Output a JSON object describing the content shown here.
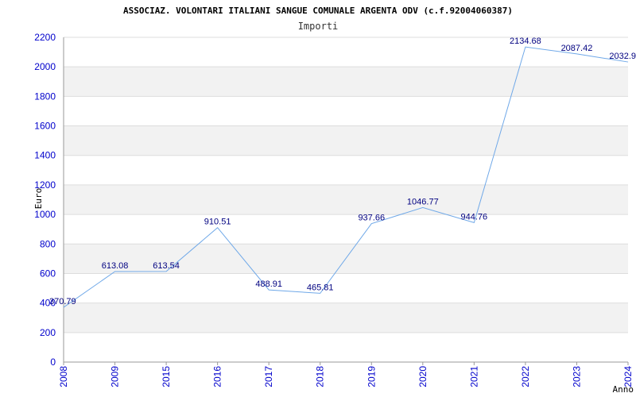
{
  "chart_data": {
    "type": "line",
    "title": "ASSOCIAZ. VOLONTARI ITALIANI SANGUE COMUNALE ARGENTA ODV (c.f.92004060387)",
    "subtitle": "Importi",
    "ylabel": "Euro",
    "xlabel": "Anno",
    "ylim": [
      0,
      2200
    ],
    "yticks": [
      "0",
      "200",
      "400",
      "600",
      "800",
      "1000",
      "1200",
      "1400",
      "1600",
      "1800",
      "2000",
      "2200"
    ],
    "categories": [
      "2008",
      "2009",
      "2015",
      "2016",
      "2017",
      "2018",
      "2019",
      "2020",
      "2021",
      "2022",
      "2023",
      "2024"
    ],
    "values": [
      370.79,
      613.08,
      613.54,
      910.51,
      488.91,
      465.81,
      937.66,
      1046.77,
      944.76,
      2134.68,
      2087.42,
      2032.9
    ],
    "labels": [
      "370.79",
      "613.08",
      "613.54",
      "910.51",
      "488.91",
      "465.81",
      "937.66",
      "1046.77",
      "944.76",
      "2134.68",
      "2087.42",
      "2032.9"
    ],
    "grid": true,
    "line_color": "#6fa8e8",
    "band_color": "#f2f2f2",
    "tick_color": "#0000cc",
    "label_color": "#000080"
  }
}
